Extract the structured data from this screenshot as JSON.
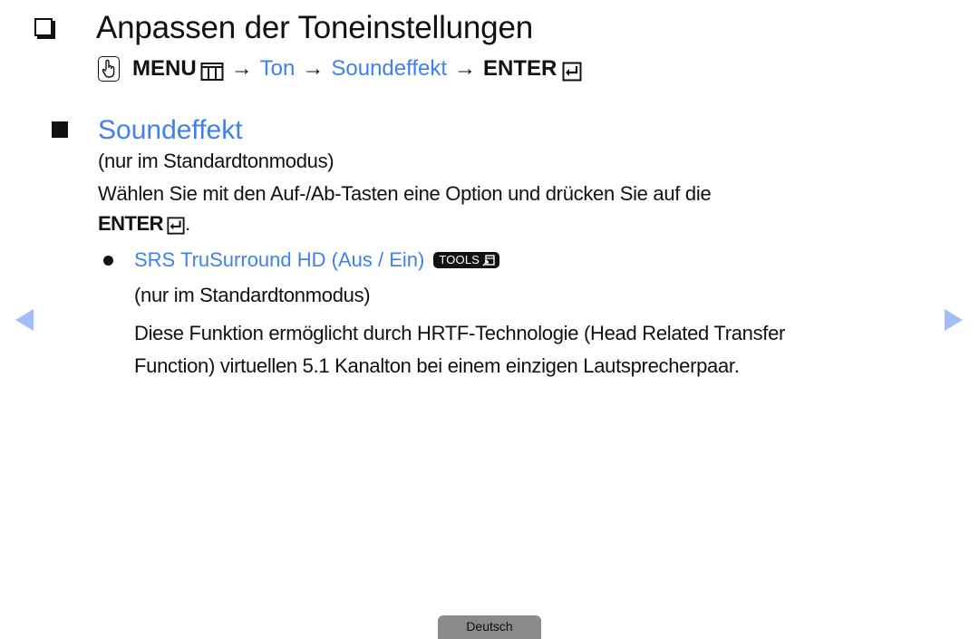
{
  "header": {
    "title": "Anpassen der Toneinstellungen",
    "title_icon": "checkbox-square-icon"
  },
  "menu_path": {
    "prefix_icon": "hand-pointer-icon",
    "menu_label": "MENU",
    "menu_icon": "menu-grid-icon",
    "arrow": "→",
    "steps": [
      "Ton",
      "Soundeffekt"
    ],
    "enter_label": "ENTER",
    "enter_icon": "enter-return-icon"
  },
  "section": {
    "icon": "filled-square-icon",
    "title": "Soundeffekt",
    "note": "(nur im Standardtonmodus)",
    "instruction": "Wählen Sie mit den Auf-/Ab-Tasten eine Option und drücken Sie auf die",
    "instruction_enter": "ENTER",
    "instruction_end": "."
  },
  "bullets": [
    {
      "title": "SRS TruSurround HD (Aus / Ein)",
      "badge": "TOOLS",
      "badge_icon": "tools-shortcut-icon",
      "note": "(nur im Standardtonmodus)",
      "description_lines": [
        "Diese Funktion ermöglicht durch HRTF-Technologie (Head Related Transfer",
        "Function) virtuellen 5.1 Kanalton bei einem einzigen Lautsprecherpaar."
      ]
    }
  ],
  "navigation": {
    "prev_icon": "triangle-left-icon",
    "next_icon": "triangle-right-icon"
  },
  "footer": {
    "language": "Deutsch"
  },
  "colors": {
    "accent_blue": "#3f7fef",
    "nav_arrow": "#a2bdf7",
    "footer_tab": "#8a8a8a",
    "text": "#111111"
  }
}
